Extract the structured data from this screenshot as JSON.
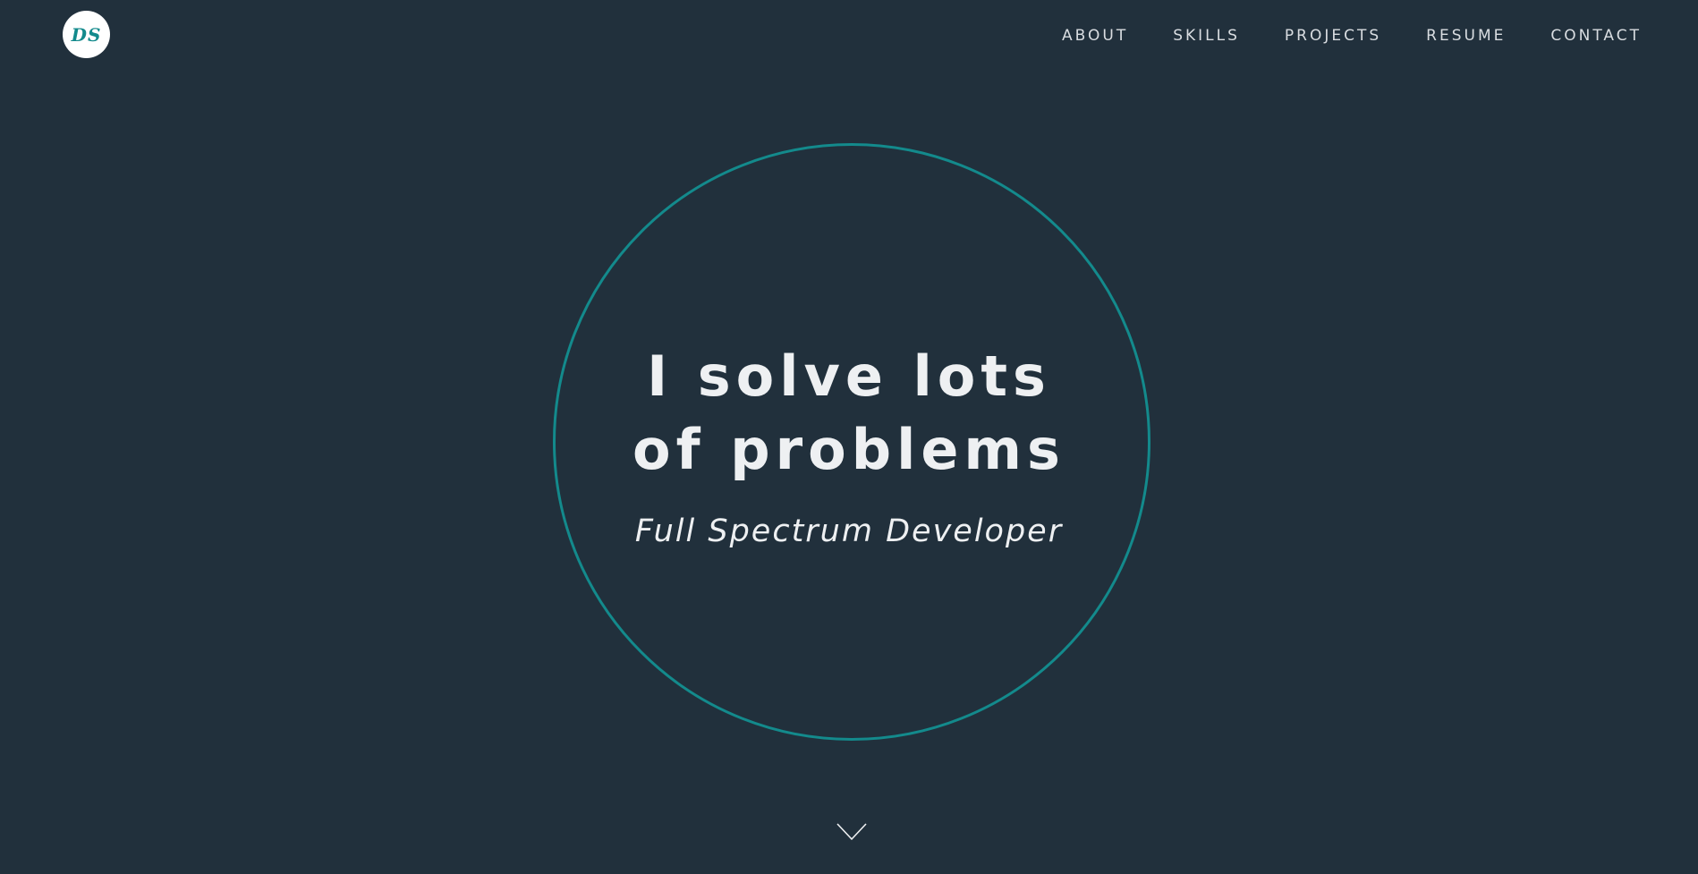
{
  "header": {
    "logo_text": "DS",
    "nav": {
      "items": [
        {
          "label": "ABOUT"
        },
        {
          "label": "SKILLS"
        },
        {
          "label": "PROJECTS"
        },
        {
          "label": "RESUME"
        },
        {
          "label": "CONTACT"
        }
      ]
    }
  },
  "hero": {
    "headline_line1": "I solve lots",
    "headline_line2": "of problems",
    "subtitle": "Full Spectrum Developer",
    "scroll_icon": "chevron-down-icon"
  },
  "colors": {
    "background": "#21303c",
    "accent": "#138a8c",
    "text": "#eef0f2",
    "nav_text": "#d9dde1",
    "logo_bg": "#ffffff"
  }
}
